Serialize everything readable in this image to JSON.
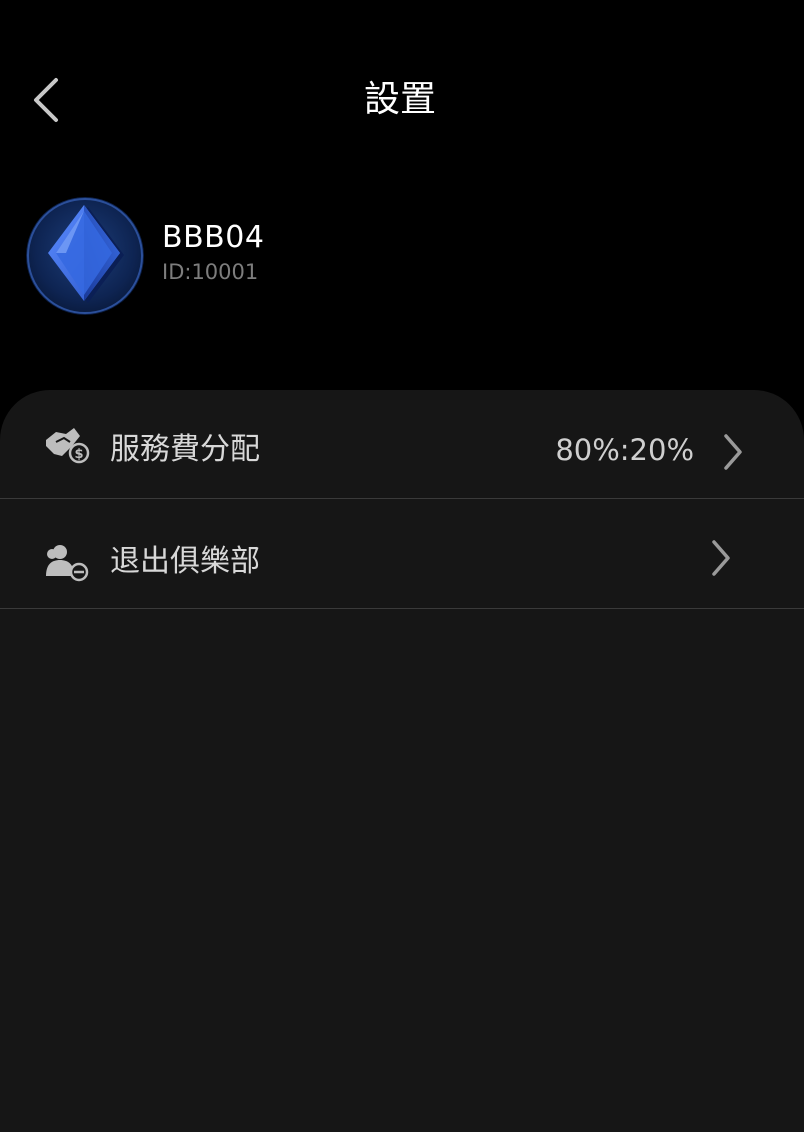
{
  "header": {
    "title": "設置",
    "back_icon": "chevron-left-icon"
  },
  "profile": {
    "avatar_icon": "diamond-suit-icon",
    "username": "BBB04",
    "user_id": "ID:10001"
  },
  "settings": [
    {
      "icon": "handshake-dollar-icon",
      "label": "服務費分配",
      "value": "80%:20%"
    },
    {
      "icon": "user-remove-icon",
      "label": "退出俱樂部",
      "value": ""
    }
  ],
  "colors": {
    "background": "#000000",
    "panel": "#161616",
    "divider": "#3a3a3a",
    "text_primary": "#ffffff",
    "text_secondary": "#7d7d7d",
    "accent_blue": "#2f63d8"
  }
}
